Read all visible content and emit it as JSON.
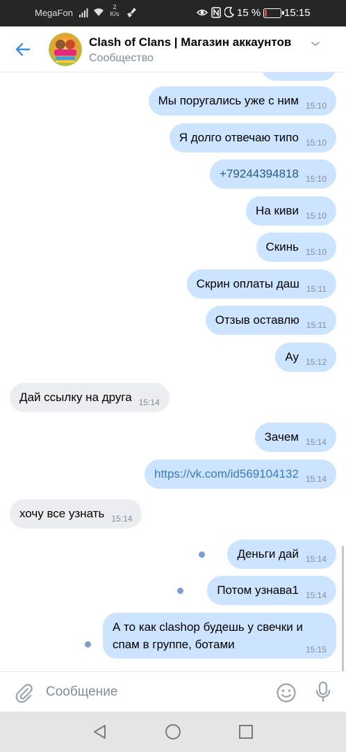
{
  "status_bar": {
    "carrier": "MegaFon",
    "speed_value": "2",
    "speed_unit": "K/s",
    "battery_text": "15 %",
    "battery_level_percent": 15,
    "time": "15:15",
    "icons": [
      "signal-icon",
      "wifi-icon",
      "cleaner-icon",
      "eye-icon",
      "nfc-icon",
      "moon-icon",
      "battery-icon"
    ]
  },
  "header": {
    "title": "Clash of Clans | Магазин аккаунтов",
    "subtitle": "Сообщество",
    "back_icon": "arrow-left-icon",
    "menu_icon": "chevron-down-icon"
  },
  "messages": [
    {
      "dir": "out",
      "text": "Мы поругались уже с ним",
      "time": "15:10"
    },
    {
      "dir": "out",
      "text": "Я долго отвечаю типо",
      "time": "15:10"
    },
    {
      "dir": "out",
      "text": "+79244394818",
      "time": "15:10",
      "link": true
    },
    {
      "dir": "out",
      "text": "На киви",
      "time": "15:10"
    },
    {
      "dir": "out",
      "text": "Скинь",
      "time": "15:10"
    },
    {
      "dir": "out",
      "text": "Скрин оплаты даш",
      "time": "15:11"
    },
    {
      "dir": "out",
      "text": "Отзыв оставлю",
      "time": "15:11"
    },
    {
      "dir": "out",
      "text": "Ау",
      "time": "15:12"
    },
    {
      "dir": "in",
      "text": "Дай ссылку на друга",
      "time": "15:14"
    },
    {
      "dir": "out",
      "text": "Зачем",
      "time": "15:14"
    },
    {
      "dir": "out",
      "text": "https://vk.com/id569104132",
      "time": "15:14",
      "link": true
    },
    {
      "dir": "in",
      "text": "хочу все узнать",
      "time": "15:14"
    },
    {
      "dir": "out",
      "text": "Деньги дай",
      "time": "15:14",
      "unread": true
    },
    {
      "dir": "out",
      "text": "Потом узнава1",
      "time": "15:14",
      "unread": true
    },
    {
      "dir": "out",
      "text": "А то как clashop будешь у свечки и спам в группе, ботами",
      "line1": "А то как clashop будешь у свечки и",
      "line2": "спам в группе, ботами",
      "time": "15:15",
      "unread": true
    }
  ],
  "composer": {
    "placeholder": "Сообщение",
    "attach_icon": "paperclip-icon",
    "emoji_icon": "emoji-icon",
    "mic_icon": "microphone-icon"
  },
  "navbar": {
    "icons": [
      "nav-back-icon",
      "nav-home-icon",
      "nav-recents-icon"
    ]
  },
  "colors": {
    "outgoing_bubble": "#cce4ff",
    "incoming_bubble": "#ebedf0",
    "accent": "#2a5885",
    "unread_dot": "#7b9ccf"
  }
}
